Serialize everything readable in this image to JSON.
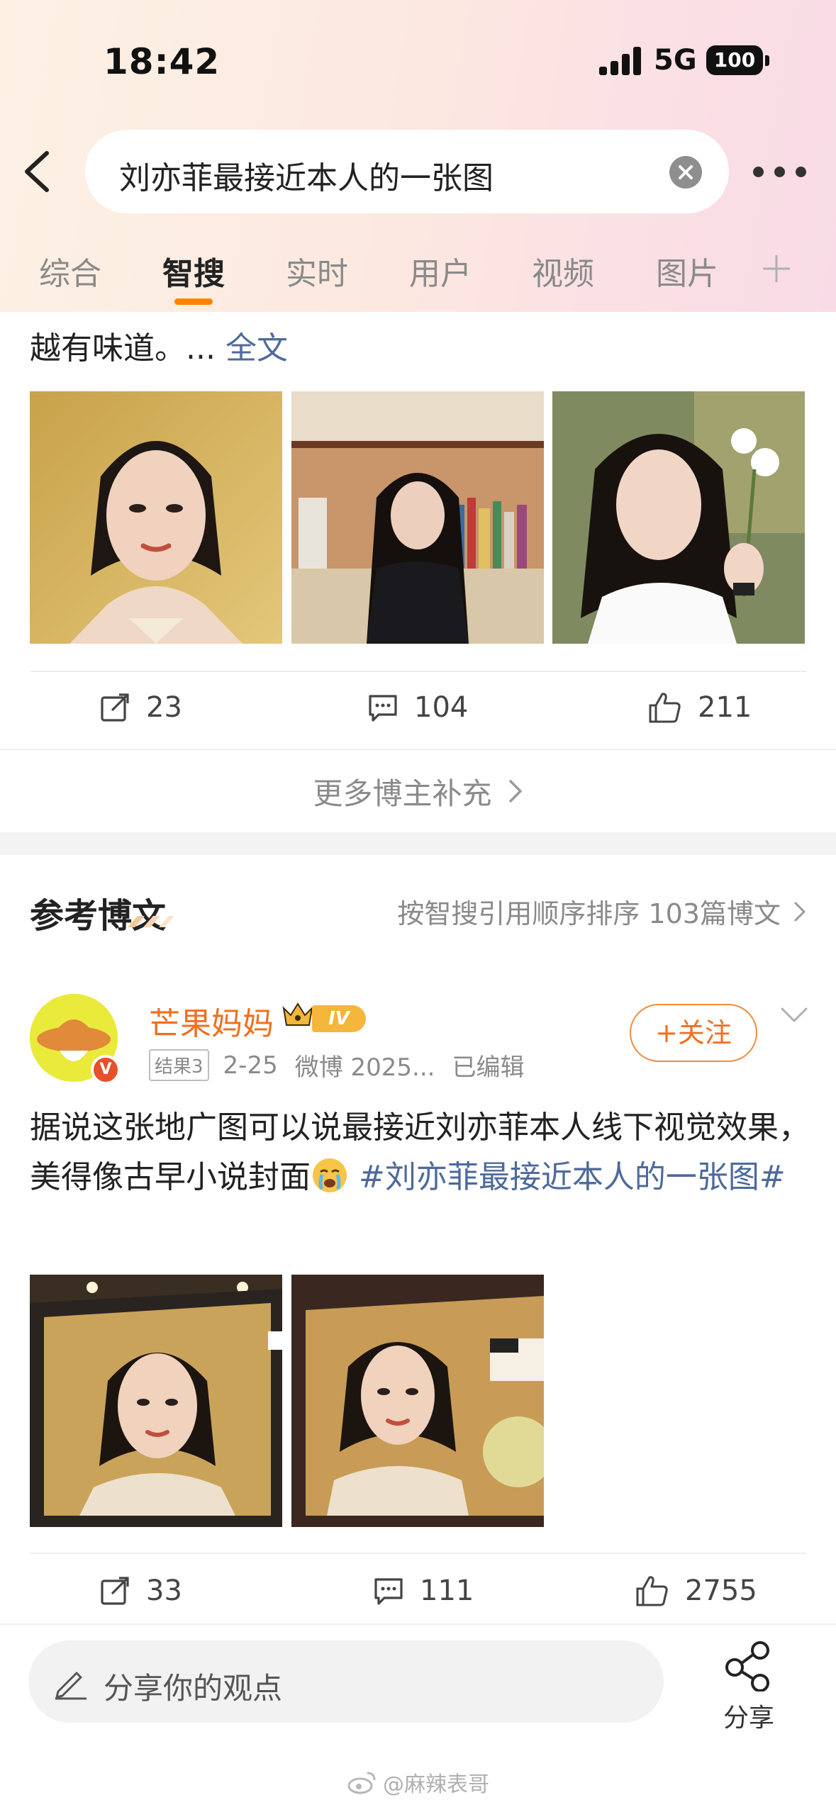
{
  "status_bar": {
    "time": "18:42",
    "network": "5G",
    "battery": "100"
  },
  "search": {
    "query": "刘亦菲最接近本人的一张图"
  },
  "tabs": [
    {
      "label": "综合",
      "active": false
    },
    {
      "label": "智搜",
      "active": true
    },
    {
      "label": "实时",
      "active": false
    },
    {
      "label": "用户",
      "active": false
    },
    {
      "label": "视频",
      "active": false
    },
    {
      "label": "图片",
      "active": false
    }
  ],
  "post1": {
    "text_tail": "越有味道。...",
    "full_text_link": "全文",
    "stats": {
      "reposts": "23",
      "comments": "104",
      "likes": "211"
    }
  },
  "more_bloggers": {
    "label": "更多博主补充"
  },
  "reference": {
    "title": "参考博文",
    "sort_label": "按智搜引用顺序排序 103篇博文"
  },
  "post2": {
    "username": "芒果妈妈",
    "level": "IV",
    "result_tag": "结果3",
    "date": "2-25",
    "source": "微博 2025...",
    "edited": "已编辑",
    "follow_label": "+关注",
    "text": "据说这张地广图可以说最接近刘亦菲本人线下视觉效果，美得像古早小说封面",
    "hashtag": "#刘亦菲最接近本人的一张图#",
    "stats": {
      "reposts": "33",
      "comments": "111",
      "likes": "2755"
    }
  },
  "bottom_bar": {
    "comment_placeholder": "分享你的观点",
    "share_label": "分享",
    "watermark": "@麻辣表哥"
  },
  "colors": {
    "accent": "#ff8200",
    "link": "#4d6a9c",
    "username": "#f0701e"
  }
}
